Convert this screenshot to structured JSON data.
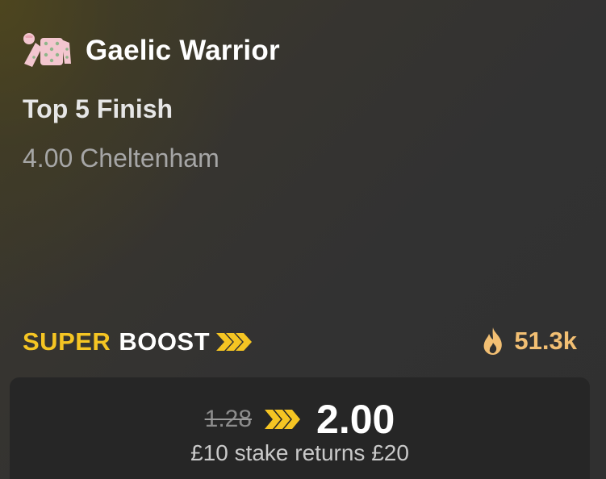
{
  "selection": {
    "silks_icon": "jockey-silks-icon",
    "horse_name": "Gaelic Warrior",
    "market": "Top 5 Finish",
    "race": "4.00 Cheltenham"
  },
  "boost": {
    "label_super": "SUPER",
    "label_boost": "BOOST",
    "chevron_icon": "double-chevron-icon",
    "popularity_icon": "flame-icon",
    "popularity_count": "51.3k"
  },
  "odds": {
    "old_price": "1.28",
    "new_price": "2.00",
    "returns_text": "£10 stake returns £20"
  },
  "colors": {
    "accent_yellow": "#f5c523",
    "flame_orange": "#f2bf73",
    "panel_bg": "#262626",
    "silks_pink": "#f3c6cf",
    "silks_dots": "#8fb58a"
  }
}
